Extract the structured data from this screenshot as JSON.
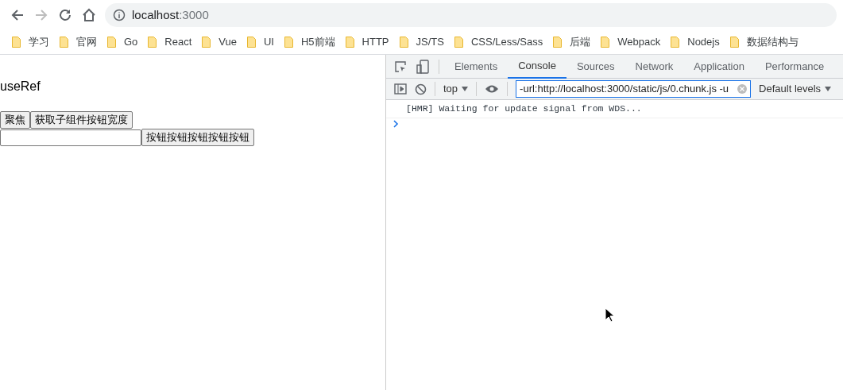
{
  "address_bar": {
    "host": "localhost",
    "port": ":3000"
  },
  "bookmarks": [
    "学习",
    "官网",
    "Go",
    "React",
    "Vue",
    "UI",
    "H5前端",
    "HTTP",
    "JS/TS",
    "CSS/Less/Sass",
    "后端",
    "Webpack",
    "Nodejs",
    "数据结构与"
  ],
  "page": {
    "heading": "useRef",
    "buttons": [
      "聚焦",
      "获取子组件按钮宽度"
    ],
    "child_button": "按钮按钮按钮按钮按钮"
  },
  "devtools": {
    "tabs": [
      {
        "label": "Elements",
        "selected": false
      },
      {
        "label": "Console",
        "selected": true
      },
      {
        "label": "Sources",
        "selected": false
      },
      {
        "label": "Network",
        "selected": false
      },
      {
        "label": "Application",
        "selected": false
      },
      {
        "label": "Performance",
        "selected": false
      }
    ],
    "context": "top",
    "filter": "-url:http://localhost:3000/static/js/0.chunk.js -u",
    "levels": "Default levels",
    "messages": [
      "[HMR] Waiting for update signal from WDS..."
    ]
  }
}
